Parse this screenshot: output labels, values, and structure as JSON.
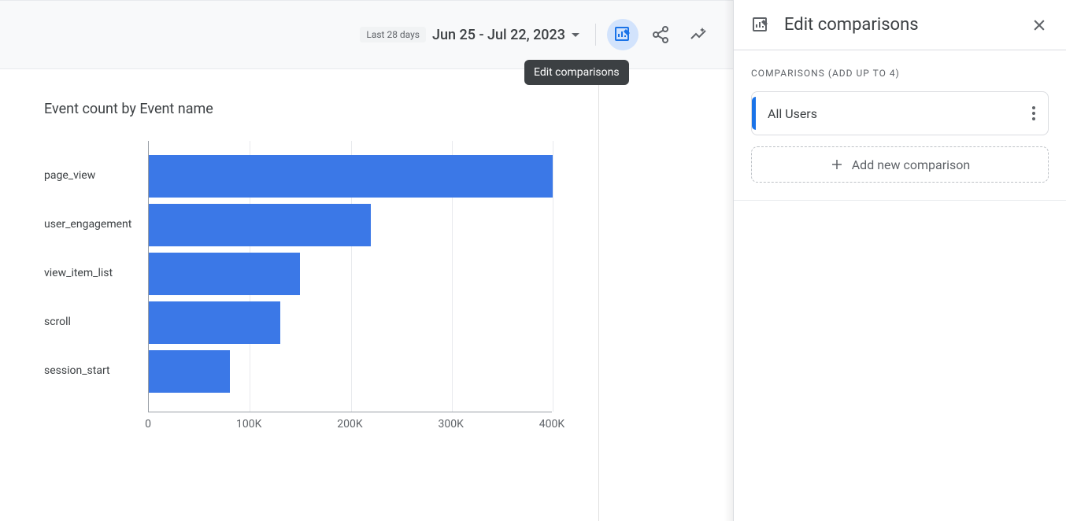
{
  "toolbar": {
    "period_badge": "Last 28 days",
    "date_range": "Jun 25 - Jul 22, 2023",
    "tooltip": "Edit comparisons"
  },
  "side_panel": {
    "title": "Edit comparisons",
    "section_label": "COMPARISONS (ADD UP TO 4)",
    "comparisons": [
      {
        "name": "All Users"
      }
    ],
    "add_label": "Add new comparison"
  },
  "chart_data": {
    "type": "bar",
    "orientation": "horizontal",
    "title": "Event count by Event name",
    "categories": [
      "page_view",
      "user_engagement",
      "view_item_list",
      "scroll",
      "session_start"
    ],
    "values": [
      400000,
      220000,
      150000,
      130000,
      80000
    ],
    "xlabel": "",
    "ylabel": "",
    "xlim": [
      0,
      400000
    ],
    "ticks": [
      0,
      100000,
      200000,
      300000,
      400000
    ],
    "tick_labels": [
      "0",
      "100K",
      "200K",
      "300K",
      "400K"
    ],
    "color": "#3b78e7"
  }
}
